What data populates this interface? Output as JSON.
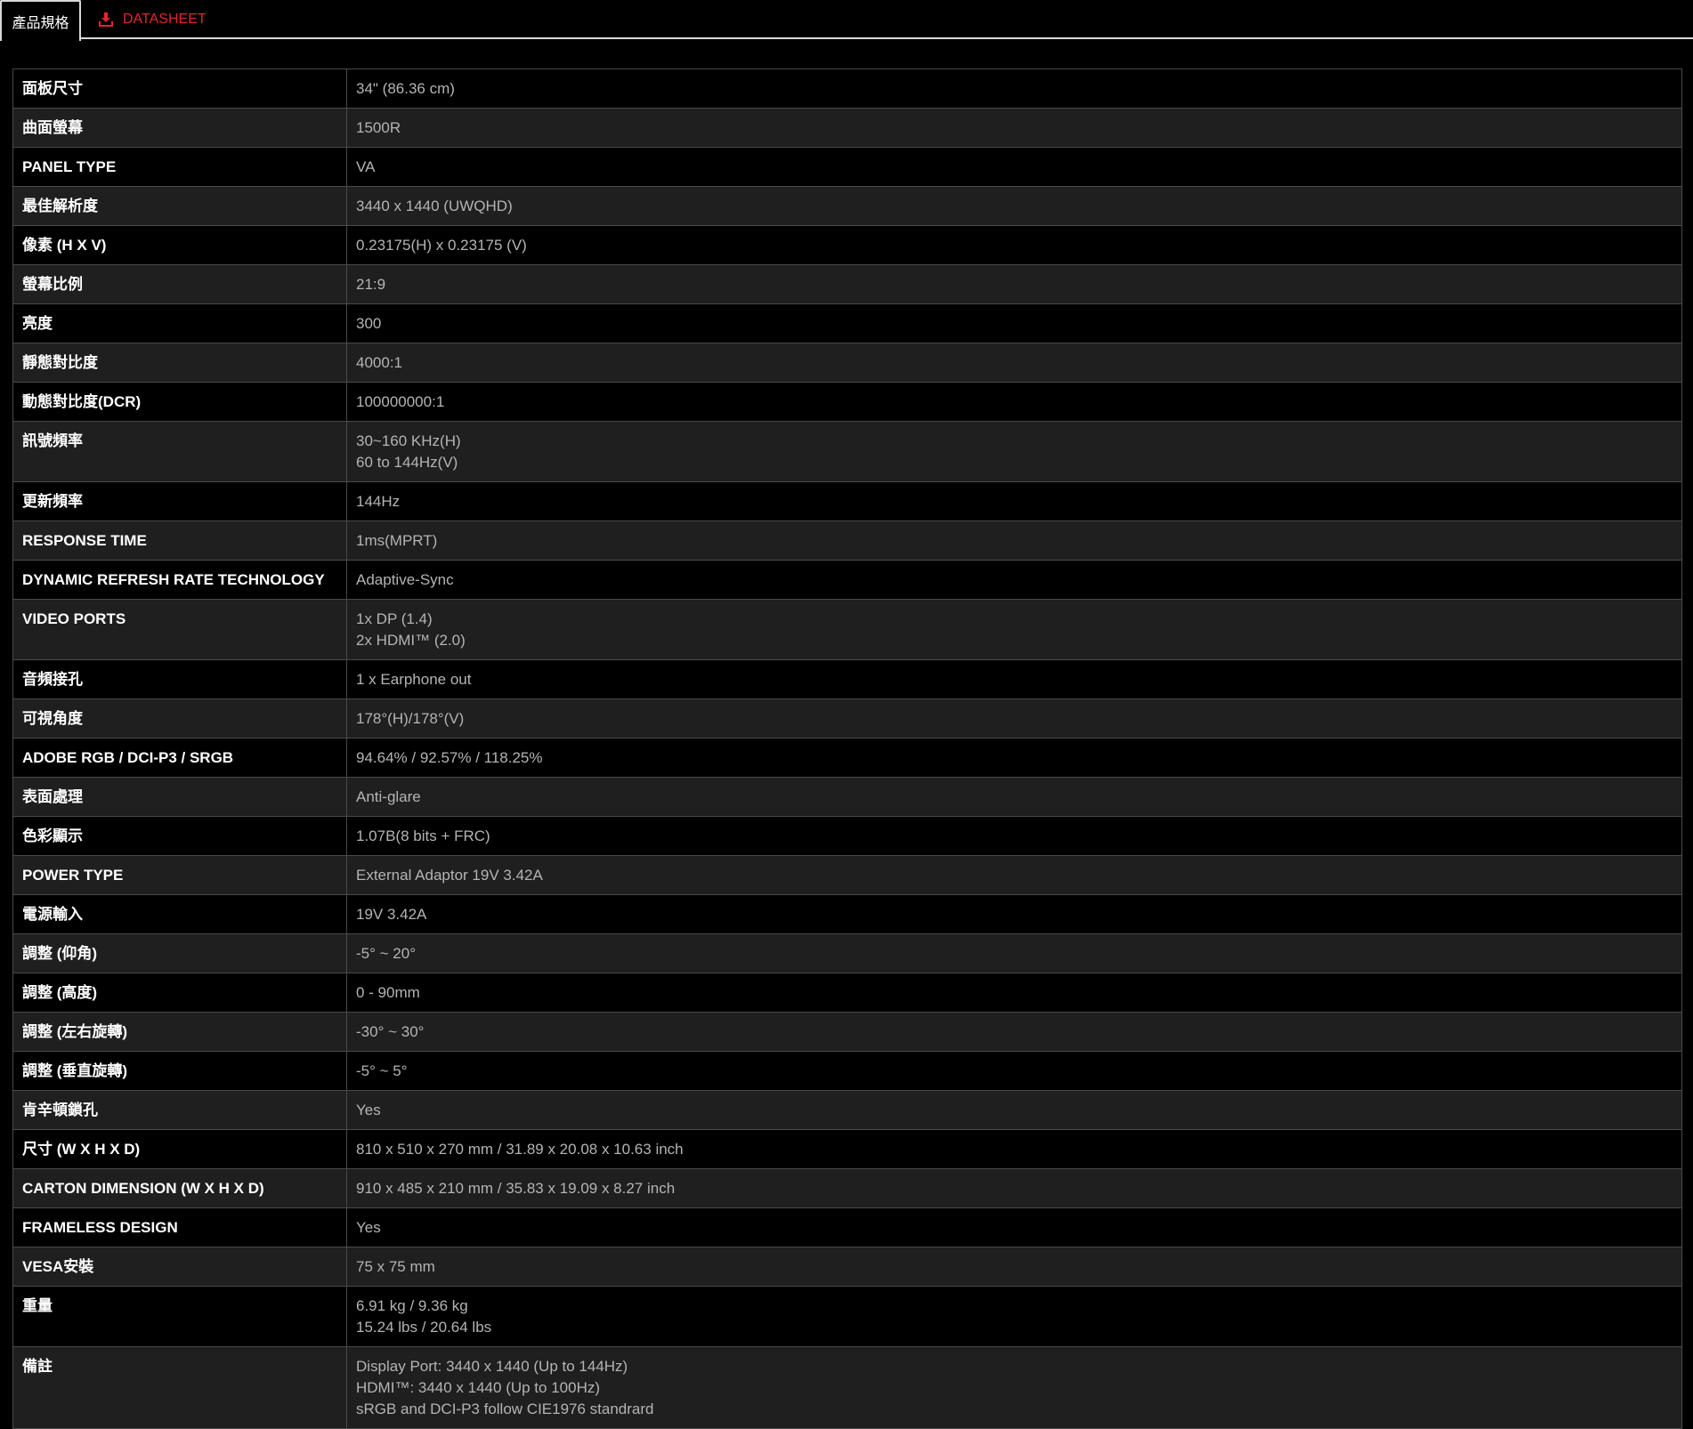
{
  "tabs": {
    "specs_label": "產品規格",
    "datasheet_label": "DATASHEET"
  },
  "colors": {
    "accent": "#e3262f",
    "row_dark": "#000000",
    "row_light": "#1f1f1f",
    "label_text": "#ffffff",
    "value_text": "#b4b4b4"
  },
  "specs": [
    {
      "label": "面板尺寸",
      "values": [
        "34\" (86.36 cm)"
      ]
    },
    {
      "label": "曲面螢幕",
      "values": [
        "1500R"
      ]
    },
    {
      "label": "PANEL TYPE",
      "values": [
        "VA"
      ]
    },
    {
      "label": "最佳解析度",
      "values": [
        "3440 x 1440 (UWQHD)"
      ]
    },
    {
      "label": "像素 (H X V)",
      "values": [
        "0.23175(H) x 0.23175 (V)"
      ]
    },
    {
      "label": "螢幕比例",
      "values": [
        "21:9"
      ]
    },
    {
      "label": "亮度",
      "values": [
        "300"
      ]
    },
    {
      "label": "靜態對比度",
      "values": [
        "4000:1"
      ]
    },
    {
      "label": "動態對比度(DCR)",
      "values": [
        "100000000:1"
      ]
    },
    {
      "label": "訊號頻率",
      "values": [
        "30~160 KHz(H)",
        "60 to 144Hz(V)"
      ]
    },
    {
      "label": "更新頻率",
      "values": [
        "144Hz"
      ]
    },
    {
      "label": "RESPONSE TIME",
      "values": [
        "1ms(MPRT)"
      ]
    },
    {
      "label": "DYNAMIC REFRESH RATE TECHNOLOGY",
      "values": [
        "Adaptive-Sync"
      ]
    },
    {
      "label": "VIDEO PORTS",
      "values": [
        "1x DP (1.4)",
        "2x HDMI™ (2.0)"
      ]
    },
    {
      "label": "音頻接孔",
      "values": [
        "1 x Earphone out"
      ]
    },
    {
      "label": "可視角度",
      "values": [
        "178°(H)/178°(V)"
      ]
    },
    {
      "label": "ADOBE RGB / DCI-P3 / SRGB",
      "values": [
        "94.64% / 92.57% / 118.25%"
      ]
    },
    {
      "label": "表面處理",
      "values": [
        "Anti-glare"
      ]
    },
    {
      "label": "色彩顯示",
      "values": [
        "1.07B(8 bits + FRC)"
      ]
    },
    {
      "label": "POWER TYPE",
      "values": [
        "External Adaptor 19V 3.42A"
      ]
    },
    {
      "label": "電源輸入",
      "values": [
        "19V 3.42A"
      ]
    },
    {
      "label": "調整 (仰角)",
      "values": [
        "-5° ~ 20°"
      ]
    },
    {
      "label": "調整 (高度)",
      "values": [
        "0 - 90mm"
      ]
    },
    {
      "label": "調整 (左右旋轉)",
      "values": [
        "-30° ~ 30°"
      ]
    },
    {
      "label": "調整 (垂直旋轉)",
      "values": [
        "-5° ~ 5°"
      ]
    },
    {
      "label": "肯辛頓鎖孔",
      "values": [
        "Yes"
      ]
    },
    {
      "label": "尺寸 (W X H X D)",
      "values": [
        "810 x 510 x 270 mm / 31.89 x 20.08 x 10.63 inch"
      ]
    },
    {
      "label": "CARTON DIMENSION (W X H X D)",
      "values": [
        "910 x 485 x 210 mm / 35.83 x 19.09 x 8.27 inch"
      ]
    },
    {
      "label": "FRAMELESS DESIGN",
      "values": [
        "Yes"
      ]
    },
    {
      "label": "VESA安裝",
      "values": [
        "75 x 75 mm"
      ]
    },
    {
      "label": "重量",
      "values": [
        "6.91 kg / 9.36 kg",
        "15.24 lbs / 20.64 lbs"
      ]
    },
    {
      "label": "備註",
      "values": [
        "Display Port: 3440 x 1440 (Up to 144Hz)",
        "HDMI™: 3440 x 1440 (Up to 100Hz)",
        "sRGB and DCI-P3 follow CIE1976 standrard"
      ]
    }
  ]
}
